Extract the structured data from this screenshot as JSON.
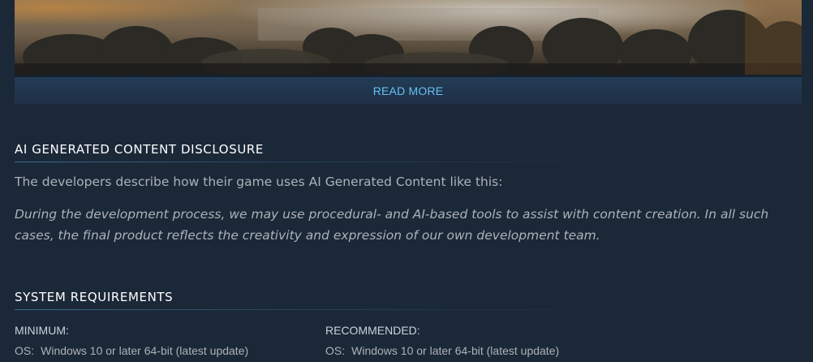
{
  "read_more": {
    "label": "READ MORE"
  },
  "ai_disclosure": {
    "title": "AI GENERATED CONTENT DISCLOSURE",
    "intro": "The developers describe how their game uses AI Generated Content like this:",
    "quote": "During the development process, we may use procedural- and AI-based tools to assist with content creation. In all such cases, the final product reflects the creativity and expression of our own development team."
  },
  "system_requirements": {
    "title": "SYSTEM REQUIREMENTS",
    "minimum": {
      "heading": "MINIMUM:",
      "os_label": "OS:",
      "os_value": "Windows 10 or later 64-bit (latest update)"
    },
    "recommended": {
      "heading": "RECOMMENDED:",
      "os_label": "OS:",
      "os_value": "Windows 10 or later 64-bit (latest update)"
    }
  },
  "colors": {
    "background": "#1b2838",
    "link": "#66c0f4",
    "heading": "#ffffff",
    "body_text": "#acb2b8"
  }
}
